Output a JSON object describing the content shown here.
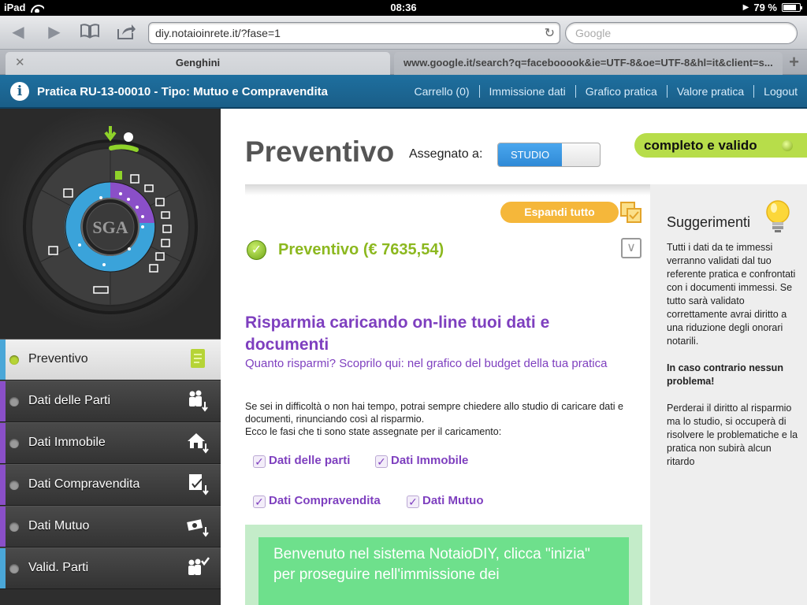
{
  "status_bar": {
    "device": "iPad",
    "time": "08:36",
    "battery": "79 %",
    "battery_level": 0.79
  },
  "browser": {
    "url": "diy.notaioinrete.it/?fase=1",
    "search_placeholder": "Google",
    "tabs": [
      {
        "title": "Genghini",
        "active": true
      },
      {
        "title": "www.google.it/search?q=facebooook&ie=UTF-8&oe=UTF-8&hl=it&client=s...",
        "active": false
      }
    ]
  },
  "header": {
    "practice_title": "Pratica RU-13-00010 - Tipo: Mutuo e Compravendita",
    "nav": [
      "Carrello (0)",
      "Immissione dati",
      "Grafico pratica",
      "Valore pratica",
      "Logout"
    ]
  },
  "wheel": {
    "center_text": "SGA"
  },
  "sidebar": {
    "items": [
      {
        "label": "Preventivo",
        "active": true,
        "bar_color": "#4aa7d8",
        "icon": "document-icon"
      },
      {
        "label": "Dati delle Parti",
        "active": false,
        "bar_color": "#8a4fc8",
        "icon": "people-icon"
      },
      {
        "label": "Dati Immobile",
        "active": false,
        "bar_color": "#8a4fc8",
        "icon": "house-icon"
      },
      {
        "label": "Dati Compravendita",
        "active": false,
        "bar_color": "#8a4fc8",
        "icon": "contract-icon"
      },
      {
        "label": "Dati Mutuo",
        "active": false,
        "bar_color": "#8a4fc8",
        "icon": "money-icon"
      },
      {
        "label": "Valid. Parti",
        "active": false,
        "bar_color": "#4aa7d8",
        "icon": "people-check-icon"
      }
    ]
  },
  "main": {
    "title": "Preventivo",
    "assigned_label": "Assegnato a:",
    "toggle_label": "STUDIO",
    "status": "completo e valido",
    "expand_all": "Espandi tutto",
    "section_title": "Preventivo (€ 7635,54)",
    "save_title": "Risparmia caricando on-line tuoi dati e documenti",
    "save_subtitle": "Quanto risparmi? Scoprilo qui: nel grafico del budget della tua pratica",
    "info_line1": "Se sei in difficoltà o non hai tempo, potrai sempre chiedere allo studio di caricare dati e documenti, rinunciando così al risparmio.",
    "info_line2": "Ecco le fasi che ti sono state assegnate per il caricamento:",
    "phases": [
      "Dati delle parti",
      "Dati Immobile",
      "Dati Compravendita",
      "Dati Mutuo"
    ],
    "welcome_text": "Benvenuto nel sistema NotaioDIY, clicca \"inizia\" per proseguire nell'immissione dei"
  },
  "tips": {
    "title": "Suggerimenti",
    "p1": "Tutti i dati da te immessi verranno validati dal tuo referente pratica e confrontati con i documenti immessi. Se tutto sarà validato correttamente avrai diritto a una riduzione degli onorari notarili.",
    "p2": "In caso contrario nessun problema!",
    "p3": "Perderai il diritto al risparmio ma lo studio, si occuperà di risolvere le problematiche e la pratica non subirà alcun ritardo"
  }
}
